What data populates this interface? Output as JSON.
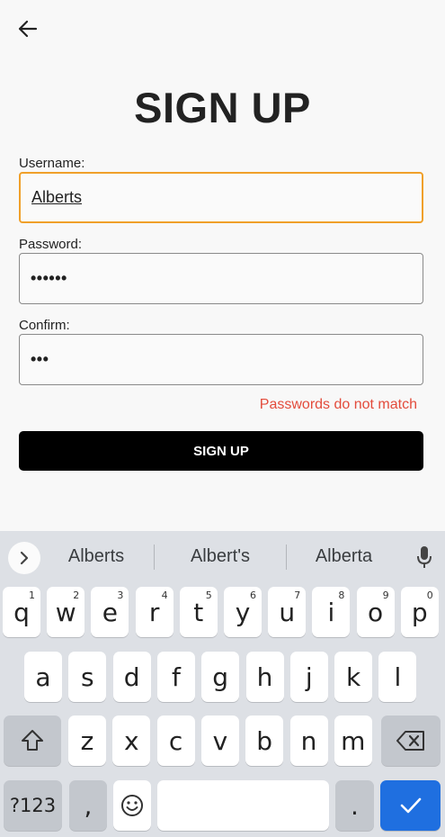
{
  "header": {
    "title": "SIGN UP"
  },
  "form": {
    "username_label": "Username:",
    "username_value": "Alberts",
    "password_label": "Password:",
    "password_value": "••••••",
    "confirm_label": "Confirm:",
    "confirm_value": "•••",
    "error_text": "Passwords do not match",
    "submit_label": "SIGN UP"
  },
  "colors": {
    "focus_border": "#f0a02a",
    "error": "#e34b3b",
    "button_bg": "#000000",
    "keyboard_bg": "#dde0e5",
    "enter_key": "#1f6fe0"
  },
  "keyboard": {
    "suggestions": [
      "Alberts",
      "Albert's",
      "Alberta"
    ],
    "row1": [
      "q",
      "w",
      "e",
      "r",
      "t",
      "y",
      "u",
      "i",
      "o",
      "p"
    ],
    "row1_numbers": [
      "1",
      "2",
      "3",
      "4",
      "5",
      "6",
      "7",
      "8",
      "9",
      "0"
    ],
    "row2": [
      "a",
      "s",
      "d",
      "f",
      "g",
      "h",
      "j",
      "k",
      "l"
    ],
    "row3": [
      "z",
      "x",
      "c",
      "v",
      "b",
      "n",
      "m"
    ],
    "symbols_label": "?123",
    "comma": ",",
    "period": ".",
    "icons": {
      "back": "arrow-left-icon",
      "expand": "chevron-right-icon",
      "mic": "microphone-icon",
      "shift": "shift-icon",
      "backspace": "backspace-icon",
      "emoji": "emoji-icon",
      "enter": "checkmark-icon"
    }
  }
}
